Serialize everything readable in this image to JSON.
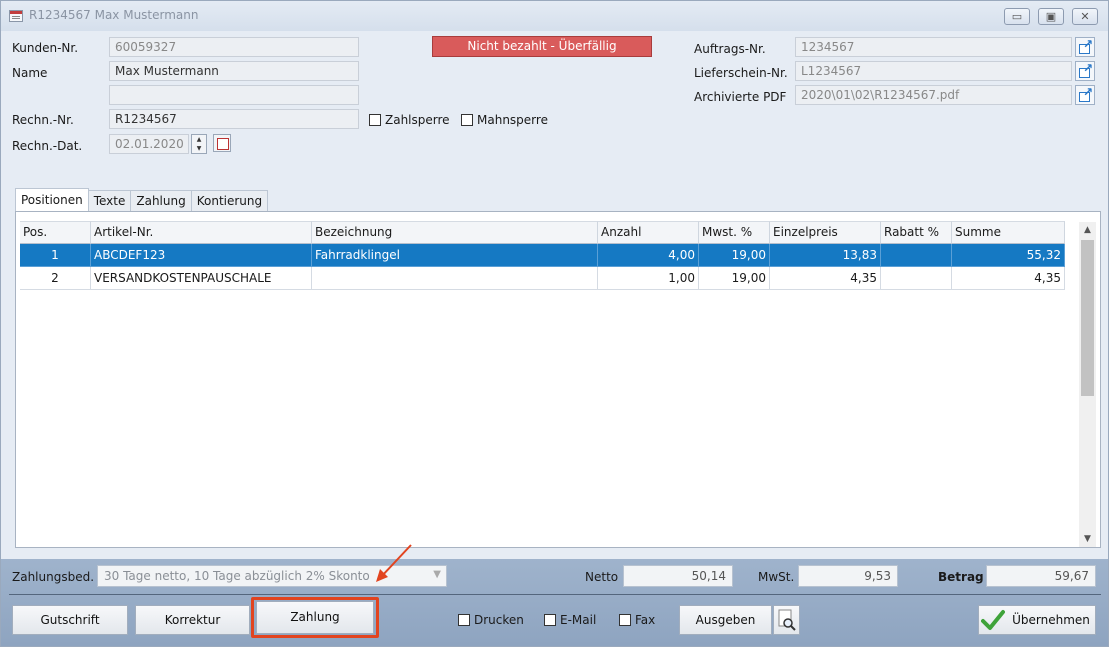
{
  "window": {
    "title": "R1234567  Max Mustermann",
    "minimize_label": "▭",
    "maximize_label": "▣",
    "close_label": "✕"
  },
  "header": {
    "kunden_nr_label": "Kunden-Nr.",
    "kunden_nr_value": "60059327",
    "name_label": "Name",
    "name_value": "Max Mustermann",
    "name2_value": "",
    "status": "Nicht bezahlt - Überfällig",
    "rechn_nr_label": "Rechn.-Nr.",
    "rechn_nr_value": "R1234567",
    "rechn_dat_label": "Rechn.-Dat.",
    "rechn_dat_value": "02.01.2020",
    "zahlsperre_label": "Zahlsperre",
    "mahnsperre_label": "Mahnsperre",
    "auftrags_nr_label": "Auftrags-Nr.",
    "auftrags_nr_value": "1234567",
    "lieferschein_nr_label": "Lieferschein-Nr.",
    "lieferschein_nr_value": "L1234567",
    "archiv_pdf_label": "Archivierte PDF",
    "archiv_pdf_value": "2020\\01\\02\\R1234567.pdf"
  },
  "tabs": [
    {
      "label": "Positionen"
    },
    {
      "label": "Texte"
    },
    {
      "label": "Zahlung"
    },
    {
      "label": "Kontierung"
    }
  ],
  "grid": {
    "columns": [
      "Pos.",
      "Artikel-Nr.",
      "Bezeichnung",
      "Anzahl",
      "Mwst. %",
      "Einzelpreis",
      "Rabatt %",
      "Summe"
    ],
    "rows": [
      {
        "pos": "1",
        "artikel": "ABCDEF123",
        "bezeichnung": "Fahrradklingel",
        "anzahl": "4,00",
        "mwst": "19,00",
        "einzelpreis": "13,83",
        "rabatt": "",
        "summe": "55,32"
      },
      {
        "pos": "2",
        "artikel": "VERSANDKOSTENPAUSCHALE",
        "bezeichnung": "",
        "anzahl": "1,00",
        "mwst": "19,00",
        "einzelpreis": "4,35",
        "rabatt": "",
        "summe": "4,35"
      }
    ]
  },
  "footer": {
    "zahlungsbed_label": "Zahlungsbed.",
    "zahlungsbed_value": "30 Tage netto, 10 Tage abzüglich 2% Skonto",
    "netto_label": "Netto",
    "netto_value": "50,14",
    "mwst_label": "MwSt.",
    "mwst_value": "9,53",
    "betrag_label": "Betrag",
    "betrag_value": "59,67"
  },
  "buttons": {
    "gutschrift": "Gutschrift",
    "korrektur": "Korrektur",
    "zahlung": "Zahlung",
    "drucken": "Drucken",
    "email": "E-Mail",
    "fax": "Fax",
    "ausgeben": "Ausgeben",
    "uebernehmen": "Übernehmen"
  },
  "colors": {
    "status_bg": "#d95b5b",
    "selection": "#1579c3",
    "highlight": "#e2441f"
  }
}
